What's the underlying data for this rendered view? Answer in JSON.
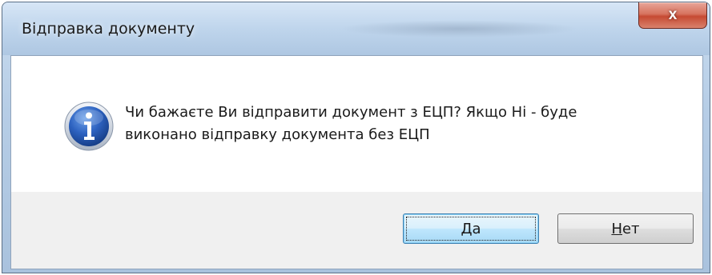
{
  "window": {
    "title": "Відправка документу",
    "close_symbol": "x"
  },
  "dialog": {
    "icon": "info-icon",
    "message_line1": "Чи бажаєте Ви відправити документ з ЕЦП? Якщо Ні - буде",
    "message_line2": "виконано відправку документа без ЕЦП"
  },
  "buttons": {
    "yes": {
      "mnemonic": "Д",
      "rest": "а"
    },
    "no": {
      "mnemonic": "Н",
      "rest": "ет"
    }
  },
  "colors": {
    "titlebar": "#bfd5ec",
    "close_button": "#c64a33",
    "info_icon": "#1d4fa5",
    "default_button_border": "#3c7fb1"
  }
}
